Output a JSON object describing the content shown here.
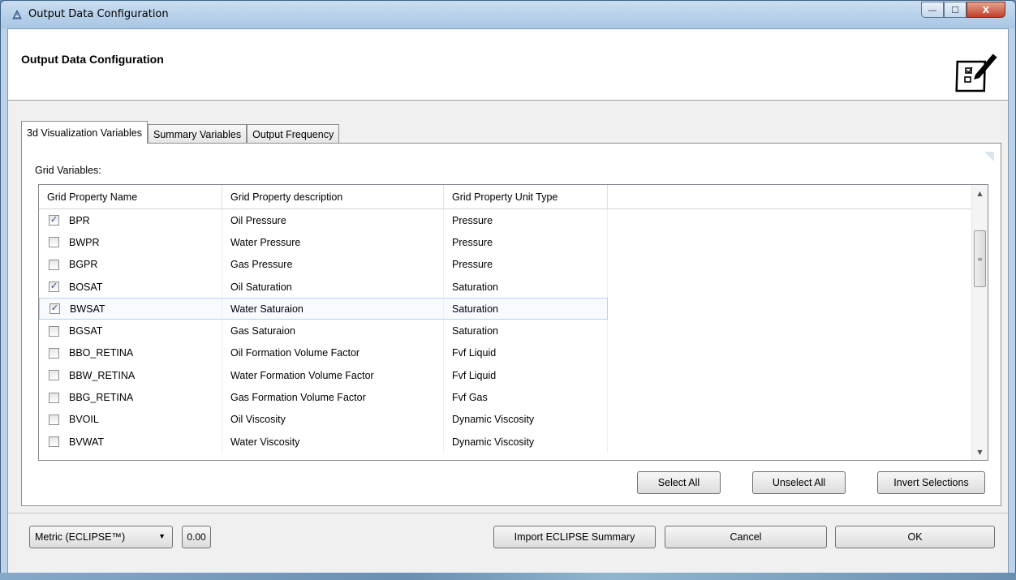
{
  "window": {
    "title": "Output Data Configuration",
    "close_glyph": "X",
    "minimize_glyph": "—",
    "maximize_glyph": "☐"
  },
  "header": {
    "title": "Output Data Configuration",
    "icon": "checklist-pencil-icon"
  },
  "tabs": [
    {
      "label": "3d Visualization Variables",
      "active": true
    },
    {
      "label": "Summary Variables",
      "active": false
    },
    {
      "label": "Output Frequency",
      "active": false
    }
  ],
  "grid": {
    "label": "Grid Variables:",
    "columns": [
      "Grid Property Name",
      "Grid Property description",
      "Grid Property Unit Type"
    ],
    "rows": [
      {
        "checked": true,
        "name": "BPR",
        "description": "Oil Pressure",
        "unit": "Pressure"
      },
      {
        "checked": false,
        "name": "BWPR",
        "description": "Water Pressure",
        "unit": "Pressure"
      },
      {
        "checked": false,
        "name": "BGPR",
        "description": "Gas Pressure",
        "unit": "Pressure"
      },
      {
        "checked": true,
        "name": "BOSAT",
        "description": "Oil Saturation",
        "unit": "Saturation"
      },
      {
        "checked": true,
        "name": "BWSAT",
        "description": "Water Saturaion",
        "unit": "Saturation",
        "selected": true
      },
      {
        "checked": false,
        "name": "BGSAT",
        "description": "Gas Saturaion",
        "unit": "Saturation"
      },
      {
        "checked": false,
        "name": "BBO_RETINA",
        "description": "Oil Formation Volume Factor",
        "unit": "Fvf Liquid"
      },
      {
        "checked": false,
        "name": "BBW_RETINA",
        "description": "Water Formation Volume Factor",
        "unit": "Fvf Liquid"
      },
      {
        "checked": false,
        "name": "BBG_RETINA",
        "description": "Gas Formation Volume Factor",
        "unit": "Fvf Gas"
      },
      {
        "checked": false,
        "name": "BVOIL",
        "description": "Oil Viscosity",
        "unit": "Dynamic Viscosity"
      },
      {
        "checked": false,
        "name": "BVWAT",
        "description": "Water Viscosity",
        "unit": "Dynamic Viscosity"
      }
    ],
    "check_glyph": "✓"
  },
  "actions": {
    "select_all": "Select All",
    "unselect_all": "Unselect All",
    "invert": "Invert Selections"
  },
  "footer": {
    "unit_system": "Metric (ECLIPSE™)",
    "version": "0.00",
    "import": "Import ECLIPSE Summary",
    "cancel": "Cancel",
    "ok": "OK"
  }
}
